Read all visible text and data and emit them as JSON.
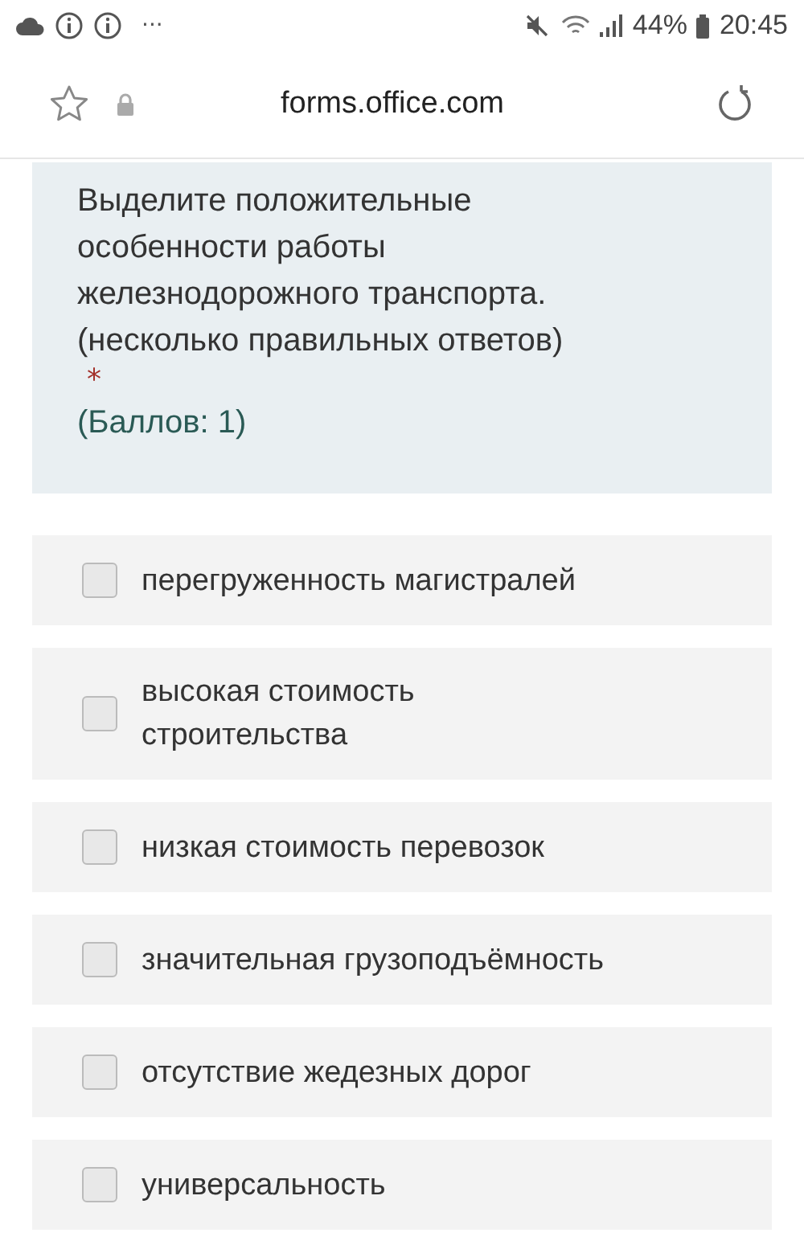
{
  "status_bar": {
    "more": "···",
    "battery": "44%",
    "time": "20:45"
  },
  "address_bar": {
    "url": "forms.office.com"
  },
  "question": {
    "text": "Выделите положительные особенности работы железнодорожного транспорта. (несколько правильных ответов)",
    "required_mark": "*",
    "points": "(Баллов: 1)"
  },
  "options": [
    {
      "label": "перегруженность магистралей",
      "checked": false
    },
    {
      "label": "высокая стоимость строительства",
      "checked": false
    },
    {
      "label": "низкая стоимость перевозок",
      "checked": false
    },
    {
      "label": "значительная грузоподъёмность",
      "checked": false
    },
    {
      "label": "отсутствие жедезных дорог",
      "checked": false
    },
    {
      "label": "универсальность",
      "checked": false
    }
  ]
}
